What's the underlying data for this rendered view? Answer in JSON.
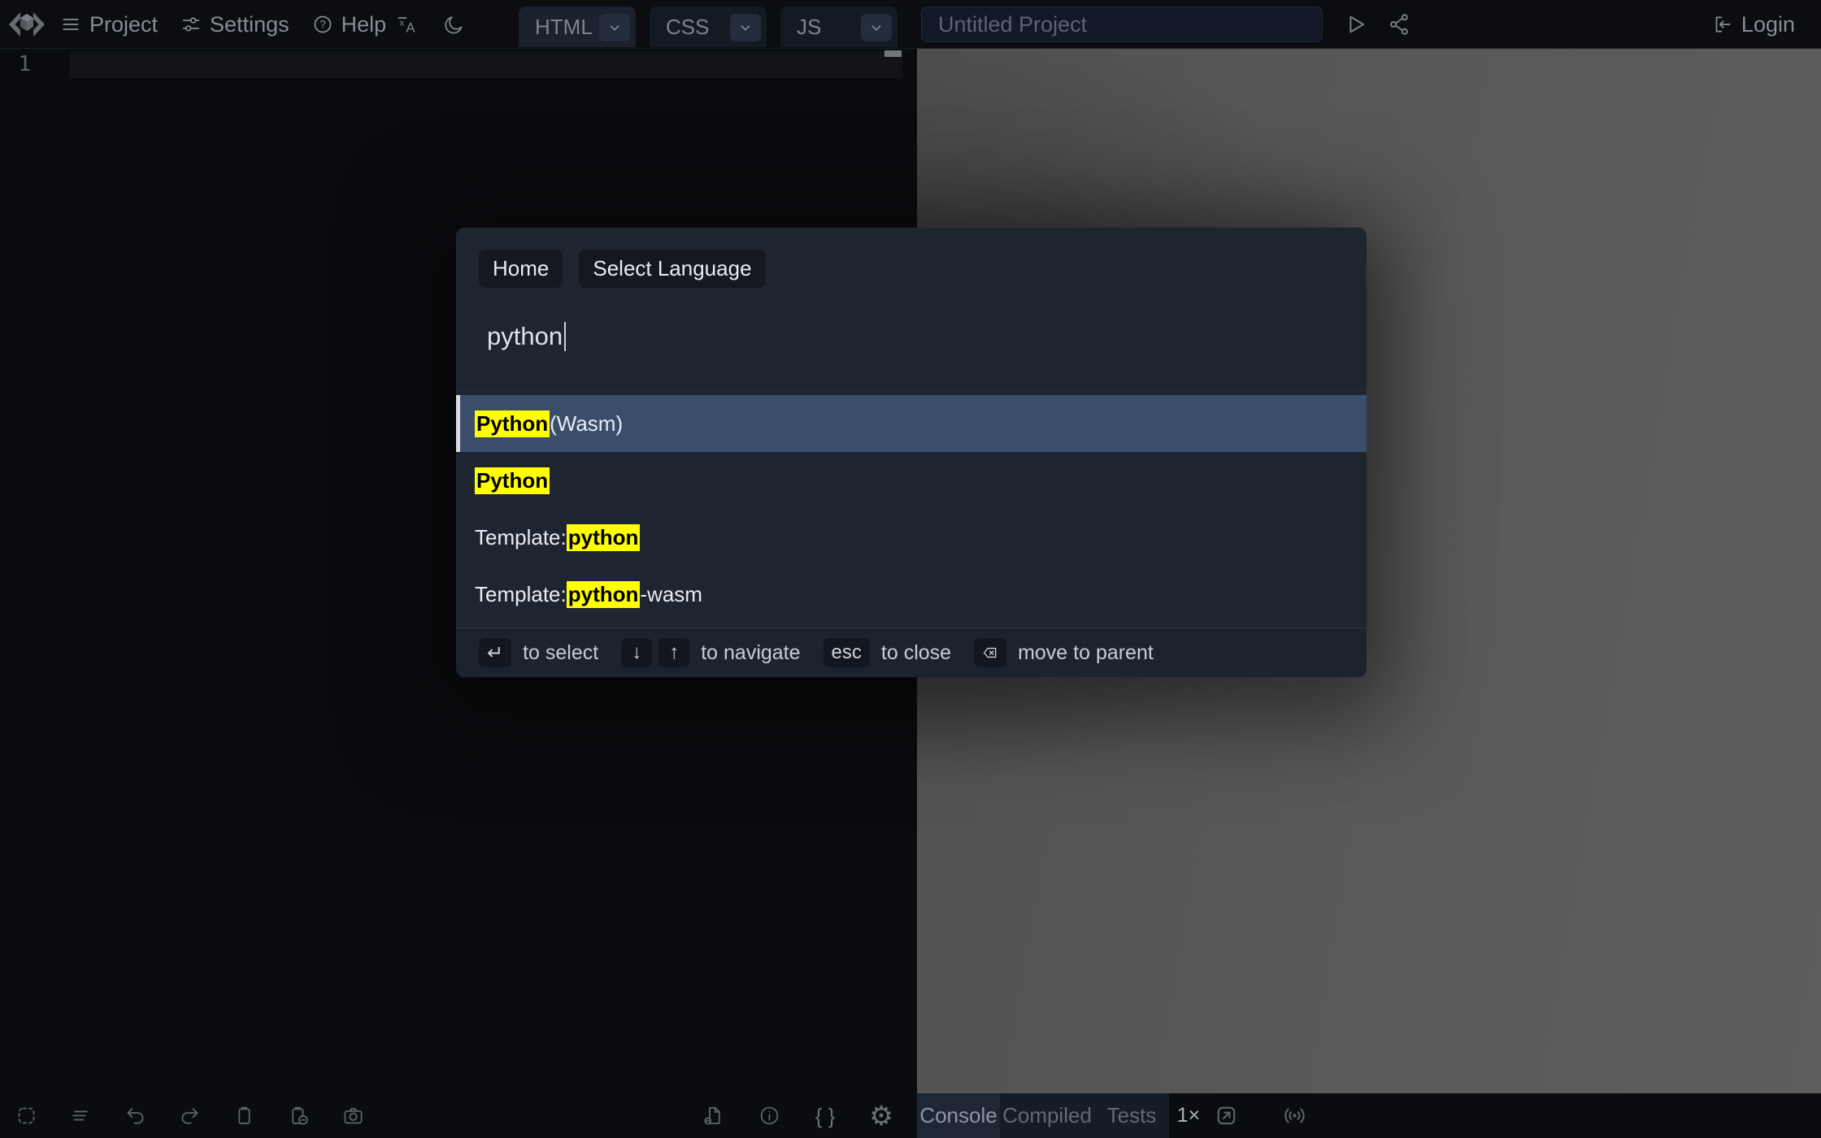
{
  "toolbar": {
    "menus": [
      {
        "label": "Project",
        "icon": "hamburger-icon"
      },
      {
        "label": "Settings",
        "icon": "sliders-icon"
      },
      {
        "label": "Help",
        "icon": "help-icon"
      }
    ],
    "quick_icons": [
      {
        "name": "translate-icon"
      },
      {
        "name": "dark-mode-icon"
      }
    ],
    "editor_tabs": [
      {
        "label": "HTML",
        "active": true
      },
      {
        "label": "CSS",
        "active": false
      },
      {
        "label": "JS",
        "active": false
      }
    ],
    "project_title_value": "Untitled Project",
    "run_share": [
      {
        "name": "run-icon"
      },
      {
        "name": "share-icon"
      }
    ],
    "login": {
      "label": "Login",
      "icon": "login-icon"
    }
  },
  "editor": {
    "line_numbers": [
      "1"
    ]
  },
  "command_palette": {
    "breadcrumbs": [
      {
        "label": "Home"
      },
      {
        "label": "Select Language"
      }
    ],
    "search": {
      "value": "python"
    },
    "results": [
      {
        "selected": true,
        "segments": [
          {
            "text": "Python",
            "highlight": true
          },
          {
            "text": " (Wasm)",
            "highlight": false
          }
        ]
      },
      {
        "selected": false,
        "segments": [
          {
            "text": "Python",
            "highlight": true
          }
        ]
      },
      {
        "selected": false,
        "segments": [
          {
            "text": "Template: ",
            "highlight": false
          },
          {
            "text": "python",
            "highlight": true
          }
        ]
      },
      {
        "selected": false,
        "segments": [
          {
            "text": "Template: ",
            "highlight": false
          },
          {
            "text": "python",
            "highlight": true
          },
          {
            "text": "-wasm",
            "highlight": false
          }
        ]
      }
    ],
    "hints": [
      {
        "keys": [
          {
            "glyph": "↵"
          }
        ],
        "label": "to select"
      },
      {
        "keys": [
          {
            "glyph": "↓"
          },
          {
            "glyph": "↑"
          }
        ],
        "label": "to navigate"
      },
      {
        "keys": [
          {
            "glyph": "esc"
          }
        ],
        "label": "to close"
      },
      {
        "keys": [
          {
            "icon": "backspace-icon"
          }
        ],
        "label": "move to parent"
      }
    ]
  },
  "statusbar": {
    "editor_tools": [
      {
        "name": "select-all-icon"
      },
      {
        "name": "format-icon"
      },
      {
        "name": "undo-icon"
      },
      {
        "name": "redo-icon"
      },
      {
        "name": "copy-icon"
      },
      {
        "name": "copy-snippet-icon"
      },
      {
        "name": "screenshot-icon"
      }
    ],
    "panel_tools": [
      {
        "name": "external-resources-icon"
      },
      {
        "name": "project-info-icon"
      },
      {
        "name": "custom-settings-icon",
        "glyph": "{ }"
      },
      {
        "name": "editor-settings-icon",
        "glyph": "⚙",
        "big": true
      }
    ],
    "result_tabs": [
      {
        "label": "Console",
        "active": true
      },
      {
        "label": "Compiled",
        "active": false
      },
      {
        "label": "Tests",
        "active": false
      }
    ],
    "zoom_label": "1×",
    "result_tools": [
      {
        "name": "open-in-new-window-icon"
      },
      {
        "name": "broadcast-icon"
      }
    ]
  },
  "colors": {
    "topbar_bg": "#0c0d10",
    "modal_bg": "#1f2530",
    "selected_row": "#3a4e6c",
    "highlight_yellow": "#ffff00",
    "preview_bg": "#565656"
  }
}
